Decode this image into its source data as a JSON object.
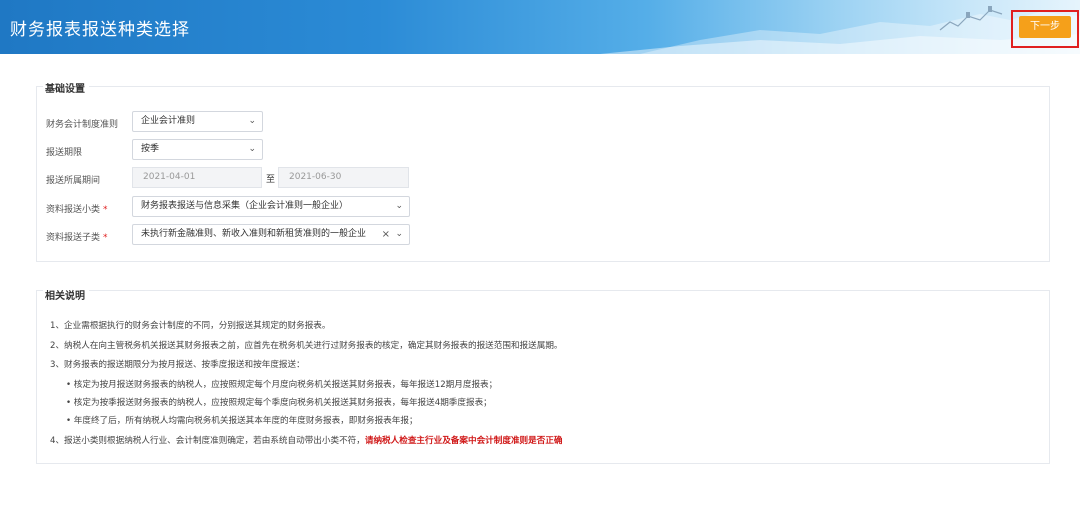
{
  "header": {
    "title": "财务报表报送种类选择",
    "next_button": "下一步"
  },
  "basic": {
    "section_title": "基础设置",
    "fields": [
      {
        "label": "财务会计制度准则",
        "required": false,
        "value": "企业会计准则"
      },
      {
        "label": "报送期限",
        "required": false,
        "value": "按季"
      },
      {
        "label": "报送所属期间",
        "required": false,
        "start": "2021-04-01",
        "separator": "至",
        "end": "2021-06-30"
      },
      {
        "label": "资料报送小类",
        "required": true,
        "value": "财务报表报送与信息采集（企业会计准则一般企业）"
      },
      {
        "label": "资料报送子类",
        "required": true,
        "value": "未执行新金融准则、新收入准则和新租赁准则的一般企业"
      }
    ],
    "required_mark": "*",
    "clear_icon": "×",
    "dropdown_icon": "⌄"
  },
  "notes": {
    "section_title": "相关说明",
    "items": [
      "1、企业需根据执行的财务会计制度的不同，分别报送其规定的财务报表。",
      "2、纳税人在向主管税务机关报送其财务报表之前，应首先在税务机关进行过财务报表的核定，确定其财务报表的报送范围和报送属期。",
      "3、财务报表的报送期限分为按月报送、按季度报送和按年度报送：",
      "• 核定为按月报送财务报表的纳税人，应按照规定每个月度向税务机关报送其财务报表，每年报送12期月度报表；",
      "• 核定为按季报送财务报表的纳税人，应按照规定每个季度向税务机关报送其财务报表，每年报送4期季度报表；",
      "• 年度终了后，所有纳税人均需向税务机关报送其本年度的年度财务报表，即财务报表年报；"
    ],
    "item4_prefix": "4、报送小类则根据纳税人行业、会计制度准则确定，若由系统自动带出小类不符，",
    "item4_warning": "请纳税人检查主行业及备案中会计制度准则是否正确"
  },
  "colors": {
    "accent_button": "#f5a01a",
    "highlight_border": "#e02020",
    "warning_text": "#d01818",
    "header_blue": "#1f78c4"
  }
}
